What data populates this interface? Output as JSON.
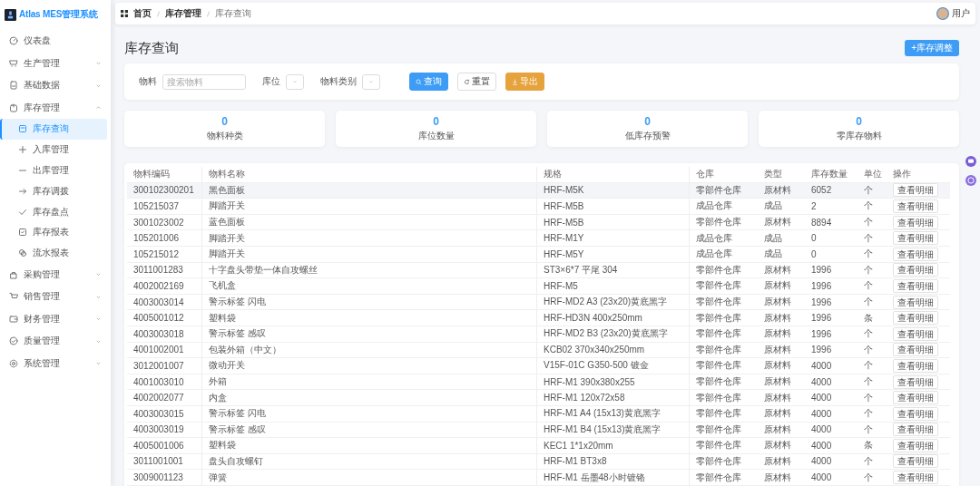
{
  "app": {
    "title": "Atlas MES管理系统"
  },
  "sidebar": {
    "items": [
      {
        "label": "仪表盘",
        "kind": "link"
      },
      {
        "label": "生产管理",
        "kind": "group",
        "expanded": false
      },
      {
        "label": "基础数据",
        "kind": "group",
        "expanded": false
      },
      {
        "label": "库存管理",
        "kind": "group",
        "expanded": true,
        "children": [
          {
            "label": "库存查询",
            "selected": true
          },
          {
            "label": "入库管理",
            "selected": false
          },
          {
            "label": "出库管理",
            "selected": false
          },
          {
            "label": "库存调拨",
            "selected": false
          },
          {
            "label": "库存盘点",
            "selected": false
          },
          {
            "label": "库存报表",
            "selected": false
          },
          {
            "label": "流水报表",
            "selected": false
          }
        ]
      },
      {
        "label": "采购管理",
        "kind": "group",
        "expanded": false
      },
      {
        "label": "销售管理",
        "kind": "group",
        "expanded": false
      },
      {
        "label": "财务管理",
        "kind": "group",
        "expanded": false
      },
      {
        "label": "质量管理",
        "kind": "group",
        "expanded": false
      },
      {
        "label": "系统管理",
        "kind": "group",
        "expanded": false
      }
    ]
  },
  "breadcrumb": [
    "首页",
    "库存管理",
    "库存查询"
  ],
  "user": {
    "name": "用户"
  },
  "page": {
    "title": "库存查询",
    "primary_button": "+库存调整"
  },
  "filters": [
    {
      "kind": "input",
      "label": "物料",
      "placeholder": "搜索物料"
    },
    {
      "kind": "select",
      "label": "库位"
    },
    {
      "kind": "select",
      "label": "物料类别"
    }
  ],
  "actions": [
    {
      "label": "查询",
      "kind": "primary"
    },
    {
      "label": "重置",
      "kind": "default"
    },
    {
      "label": "导出",
      "kind": "warning"
    }
  ],
  "stats": [
    {
      "value": "0",
      "label": "物料种类"
    },
    {
      "value": "0",
      "label": "库位数量"
    },
    {
      "value": "0",
      "label": "低库存预警"
    },
    {
      "value": "0",
      "label": "零库存物料"
    }
  ],
  "table": {
    "columns": [
      "物料编码",
      "物料名称",
      "规格",
      "仓库",
      "类型",
      "库存数量",
      "单位",
      "操作"
    ],
    "rows": [
      {
        "cells": [
          "300102300201",
          "黑色面板",
          "HRF-M5K",
          "零部件仓库",
          "原材料",
          "6052",
          "个"
        ],
        "action": "查看明细",
        "selected": true
      },
      {
        "cells": [
          "105215037",
          "脚踏开关",
          "HRF-M5B",
          "成品仓库",
          "成品",
          "2",
          "个"
        ],
        "action": "查看明细",
        "selected": false
      },
      {
        "cells": [
          "3001023002",
          "蓝色面板",
          "HRF-M5B",
          "零部件仓库",
          "原材料",
          "8894",
          "个"
        ],
        "action": "查看明细",
        "selected": false
      },
      {
        "cells": [
          "105201006",
          "脚踏开关",
          "HRF-M1Y",
          "成品仓库",
          "成品",
          "0",
          "个"
        ],
        "action": "查看明细",
        "selected": false
      },
      {
        "cells": [
          "105215012",
          "脚踏开关",
          "HRF-M5Y",
          "成品仓库",
          "成品",
          "0",
          "个"
        ],
        "action": "查看明细",
        "selected": false
      },
      {
        "cells": [
          "3011001283",
          "十字盘头带垫一体自攻螺丝",
          "ST3×6*7 平尾 304",
          "零部件仓库",
          "原材料",
          "1996",
          "个"
        ],
        "action": "查看明细",
        "selected": false
      },
      {
        "cells": [
          "4002002169",
          "飞机盒",
          "HRF-M5",
          "零部件仓库",
          "原材料",
          "1996",
          "个"
        ],
        "action": "查看明细",
        "selected": false
      },
      {
        "cells": [
          "4003003014",
          "警示标签 闪电",
          "HRF-MD2 A3 (23x20)黄底黑字",
          "零部件仓库",
          "原材料",
          "1996",
          "个"
        ],
        "action": "查看明细",
        "selected": false
      },
      {
        "cells": [
          "4005001012",
          "塑料袋",
          "HRF-HD3N 400x250mm",
          "零部件仓库",
          "原材料",
          "1996",
          "条"
        ],
        "action": "查看明细",
        "selected": false
      },
      {
        "cells": [
          "4003003018",
          "警示标签 感叹",
          "HRF-MD2 B3 (23x20)黄底黑字",
          "零部件仓库",
          "原材料",
          "1996",
          "个"
        ],
        "action": "查看明细",
        "selected": false
      },
      {
        "cells": [
          "4001002001",
          "包装外箱（中文）",
          "KCB02 370x340x250mm",
          "零部件仓库",
          "原材料",
          "1996",
          "个"
        ],
        "action": "查看明细",
        "selected": false
      },
      {
        "cells": [
          "3012001007",
          "微动开关",
          "V15F-01C G350-500 镀金",
          "零部件仓库",
          "原材料",
          "4000",
          "个"
        ],
        "action": "查看明细",
        "selected": false
      },
      {
        "cells": [
          "4001003010",
          "外箱",
          "HRF-M1 390x380x255",
          "零部件仓库",
          "原材料",
          "4000",
          "个"
        ],
        "action": "查看明细",
        "selected": false
      },
      {
        "cells": [
          "4002002077",
          "内盒",
          "HRF-M1 120x72x58",
          "零部件仓库",
          "原材料",
          "4000",
          "个"
        ],
        "action": "查看明细",
        "selected": false
      },
      {
        "cells": [
          "4003003015",
          "警示标签 闪电",
          "HRF-M1 A4 (15x13)黄底黑字",
          "零部件仓库",
          "原材料",
          "4000",
          "个"
        ],
        "action": "查看明细",
        "selected": false
      },
      {
        "cells": [
          "4003003019",
          "警示标签 感叹",
          "HRF-M1 B4 (15x13)黄底黑字",
          "零部件仓库",
          "原材料",
          "4000",
          "个"
        ],
        "action": "查看明细",
        "selected": false
      },
      {
        "cells": [
          "4005001006",
          "塑料袋",
          "KEC1 1*1x20mm",
          "零部件仓库",
          "原材料",
          "4000",
          "条"
        ],
        "action": "查看明细",
        "selected": false
      },
      {
        "cells": [
          "3011001001",
          "盘头自攻螺钉",
          "HRF-M1 BT3x8",
          "零部件仓库",
          "原材料",
          "4000",
          "个"
        ],
        "action": "查看明细",
        "selected": false
      },
      {
        "cells": [
          "3009001123",
          "弹簧",
          "HRF-M1 岳墨48小时镀铬",
          "零部件仓库",
          "原材料",
          "4000",
          "个"
        ],
        "action": "查看明细",
        "selected": false
      }
    ]
  }
}
